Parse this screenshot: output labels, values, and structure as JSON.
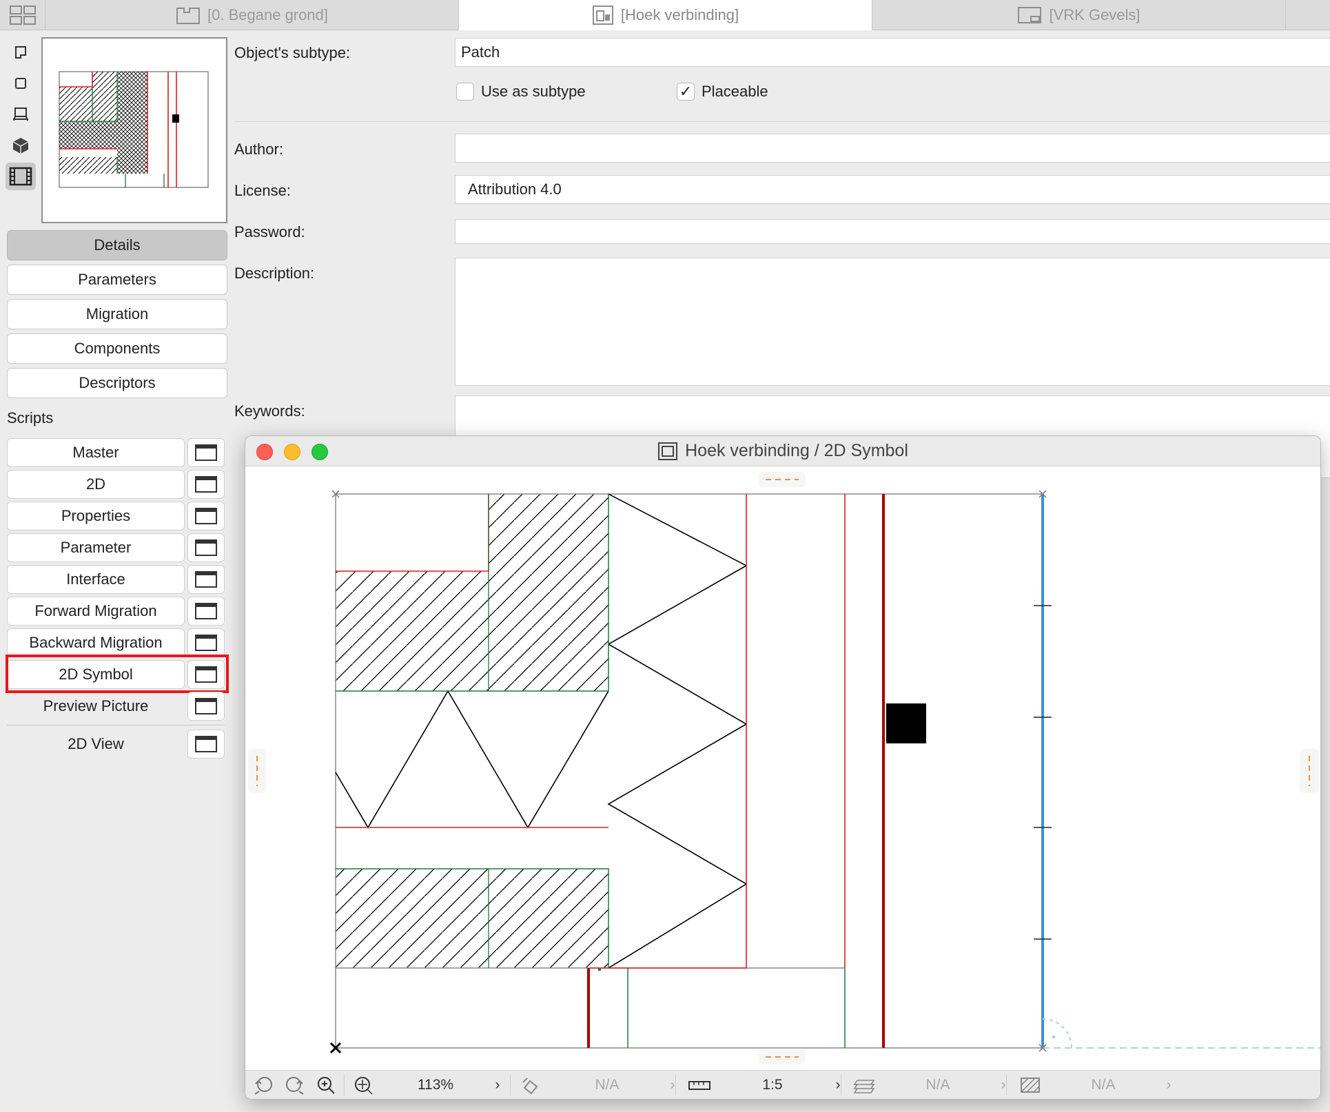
{
  "tabs": [
    {
      "label": "[0. Begane grond]",
      "icon": "floor-plan-icon"
    },
    {
      "label": "[Hoek verbinding]",
      "icon": "library-part-icon"
    },
    {
      "label": "[VRK Gevels]",
      "icon": "layout-icon"
    }
  ],
  "nav": {
    "details": "Details",
    "parameters": "Parameters",
    "migration": "Migration",
    "components": "Components",
    "descriptors": "Descriptors"
  },
  "scripts": {
    "heading": "Scripts",
    "items": [
      "Master",
      "2D",
      "Properties",
      "Parameter",
      "Interface",
      "Forward Migration",
      "Backward Migration",
      "2D Symbol",
      "Preview Picture",
      "2D View"
    ],
    "highlighted": "2D Symbol"
  },
  "form": {
    "subtype_label": "Object's subtype:",
    "subtype_value": "Patch",
    "use_as_subtype_label": "Use as subtype",
    "use_as_subtype_checked": false,
    "placeable_label": "Placeable",
    "placeable_checked": true,
    "placeable_mark": "✓",
    "author_label": "Author:",
    "author_value": "",
    "license_label": "License:",
    "license_value": "Attribution 4.0",
    "password_label": "Password:",
    "password_value": "",
    "description_label": "Description:",
    "description_value": "",
    "keywords_label": "Keywords:",
    "keywords_value": ""
  },
  "window": {
    "title": "Hoek verbinding / 2D Symbol",
    "status": {
      "zoom": "113%",
      "angle": "N/A",
      "scale": "1:5",
      "layer": "N/A",
      "pen": "N/A",
      "chevron": "›"
    }
  },
  "colors": {
    "highlight": "#e8181c",
    "red_line": "#e21b1b",
    "dark_red_line": "#a80000",
    "green_line": "#1d7a3a",
    "blue_hotspot": "#3d8fd9",
    "orange_marker": "#f0922e"
  }
}
